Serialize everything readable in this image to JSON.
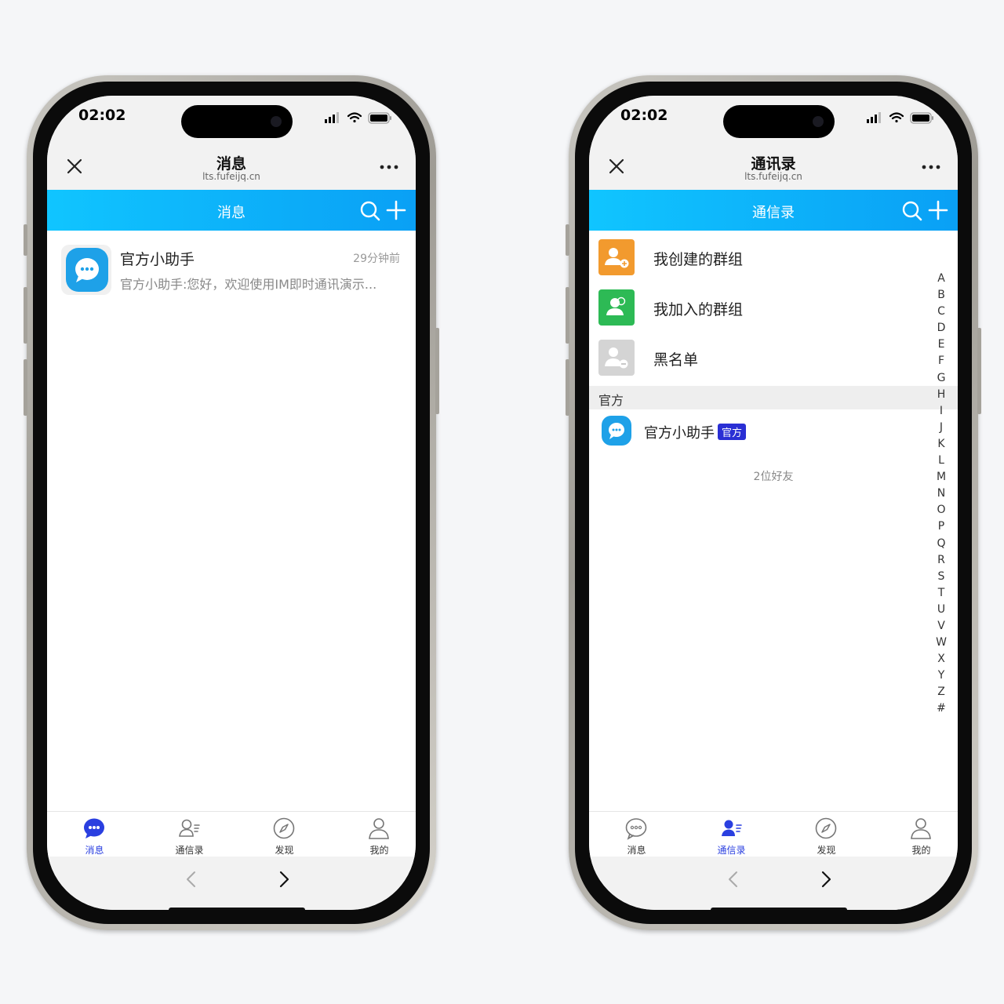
{
  "left_screen": {
    "status": {
      "time": "02:02"
    },
    "title": "消息",
    "url": "lts.fufeijq.cn",
    "header_title": "消息",
    "chat": {
      "name": "官方小助手",
      "time": "29分钟前",
      "preview": "官方小助手:您好，欢迎使用IM即时通讯演示..."
    },
    "tabs": [
      "消息",
      "通信录",
      "发现",
      "我的"
    ],
    "active_tab": "消息"
  },
  "right_screen": {
    "status": {
      "time": "02:02"
    },
    "title": "通讯录",
    "url": "lts.fufeijq.cn",
    "header_title": "通信录",
    "entries": [
      "我创建的群组",
      "我加入的群组",
      "黑名单"
    ],
    "section": "官方",
    "contact": {
      "name": "官方小助手",
      "badge": "官方"
    },
    "friend_count": "2位好友",
    "index_letters": [
      "A",
      "B",
      "C",
      "D",
      "E",
      "F",
      "G",
      "H",
      "I",
      "J",
      "K",
      "L",
      "M",
      "N",
      "O",
      "P",
      "Q",
      "R",
      "S",
      "T",
      "U",
      "V",
      "W",
      "X",
      "Y",
      "Z",
      "#"
    ],
    "tabs": [
      "消息",
      "通信录",
      "发现",
      "我的"
    ],
    "active_tab": "通信录"
  },
  "colors": {
    "header_gradient_start": "#10c5ff",
    "header_gradient_end": "#0aa0f5",
    "active_tab": "#2a3fe0",
    "group_created": "#f29a2e",
    "group_joined": "#2dba55",
    "blacklist": "#cfcfcf",
    "official_badge": "#2a2fd4"
  },
  "icons": [
    "close-icon",
    "more-icon",
    "search-icon",
    "plus-icon",
    "chat-bubble-icon",
    "contacts-icon",
    "compass-icon",
    "user-icon",
    "back-arrow-icon",
    "forward-arrow-icon",
    "signal-icon",
    "wifi-icon",
    "battery-icon"
  ]
}
